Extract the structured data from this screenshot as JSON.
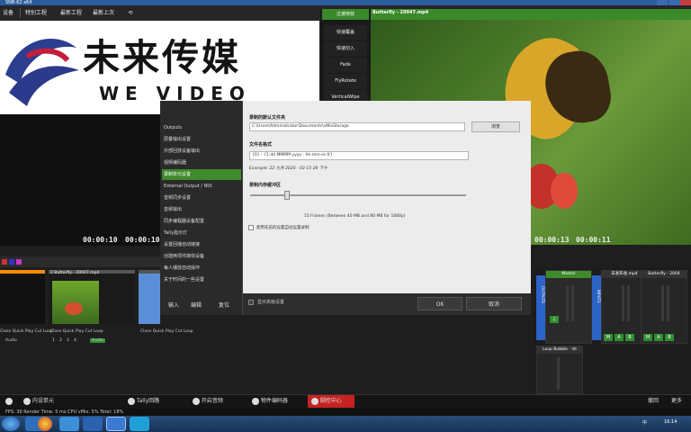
{
  "window": {
    "title": "SNB-62 x64"
  },
  "menu": {
    "items": [
      "设备",
      "特别工程",
      "最新工程",
      "最新上次"
    ],
    "right_items": [
      "录像输入",
      "基本画像"
    ]
  },
  "logo": {
    "cn_text": "未来传媒",
    "en_text": "WE VIDEO"
  },
  "transitions": {
    "header": "过渡特效",
    "buttons": [
      "快速覆盖",
      "快速切入",
      "Fade",
      "FlyRotate",
      "VerticalWipe"
    ]
  },
  "preview": {
    "left_time_a": "00:00:10",
    "left_time_b": "00:00:10",
    "right_title": "Butterfly - 20047.mp4",
    "right_time_a": "00:00:13",
    "right_time_b": "00:00:11"
  },
  "dialog": {
    "nav_items": [
      "Outputs",
      "层叠输出设置",
      "外部回放设备输出",
      "视频编码器",
      "录制单元设置",
      "External Output / NDI",
      "音频同步设置",
      "音频输出",
      "同步编程器设备配置",
      "Tally指示灯",
      "设置回播自动链接",
      "创建两项件媒体设备",
      "每人播放自动操作",
      "关于时间的一些设置"
    ],
    "active_index": 4,
    "folder_label": "录制的默认文件夹",
    "folder_value": "C:\\Users\\Administrator\\Documents\\vMixStorage",
    "browse_label": "浏览",
    "format_label": "文件名格式",
    "format_value": "{0} - {1:dd MMMM yyyy - hh-mm-ss tt}",
    "format_example": "Example: 22 九月 2020 - 03-15-28 下午",
    "buffer_label": "录制内存缓冲区",
    "buffer_readout": "15 Frames (Between 40 MB and 80 MB for 1080p)",
    "buffer_value": 0.17,
    "checkbox_label": "使用先前的设置自动设置录制",
    "bottom_checkbox": "显示高级设置",
    "ok_label": "OK",
    "cancel_label": "取消",
    "footer": {
      "left": "输入",
      "mid": "编辑",
      "right": "复位"
    }
  },
  "inputs": {
    "tiles": [
      {
        "name": "",
        "bar": "Close Quick Play Cut Loop"
      },
      {
        "name": "2  Butterfly - 20047.mp4",
        "bar": "Close Quick Play Cut Loop"
      },
      {
        "name": "",
        "bar": "Close Quick Play Cut Loop"
      }
    ],
    "audio_label": "Audio",
    "numbers": [
      "1",
      "2",
      "3",
      "4"
    ]
  },
  "audio": {
    "master_label": "Master",
    "ch2_label": "未发布会.mp4",
    "ch3_label": "Butterfly - 2004",
    "side_labels": [
      "OUTPUTS",
      "INPUTS"
    ],
    "loop_label": "Loop Bubble - Ve",
    "mute_letters": [
      "M",
      "A",
      "B"
    ]
  },
  "bottom_bar": {
    "items": [
      "内设单元",
      "Tally回路",
      "开启音频",
      "物件编码器",
      "脚控中心"
    ],
    "right_items": [
      "撤回",
      "更多"
    ]
  },
  "status": {
    "text": "FPS: 30 Render Time: 5 ms CPU vMix: 5% Total: 18%"
  },
  "taskbar": {
    "time": "16:14",
    "lang": "中"
  }
}
